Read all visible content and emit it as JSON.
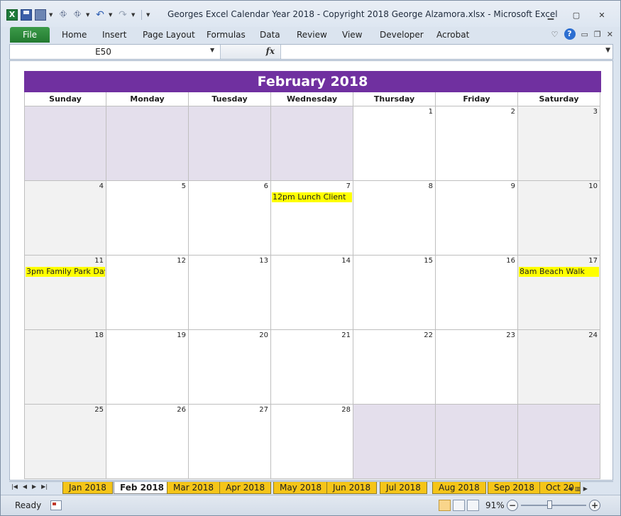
{
  "window": {
    "title": "Georges Excel Calendar Year 2018  -  Copyright 2018 George Alzamora.xlsx  -  Microsoft Excel"
  },
  "ribbon": {
    "file_label": "File",
    "tabs": [
      "Home",
      "Insert",
      "Page Layout",
      "Formulas",
      "Data",
      "Review",
      "View",
      "Developer",
      "Acrobat"
    ]
  },
  "formula_bar": {
    "name_box": "E50",
    "fx_label": "fx",
    "formula": ""
  },
  "calendar": {
    "title": "February 2018",
    "days_of_week": [
      "Sunday",
      "Monday",
      "Tuesday",
      "Wednesday",
      "Thursday",
      "Friday",
      "Saturday"
    ],
    "weeks": [
      [
        "",
        "",
        "",
        "",
        "1",
        "2",
        "3"
      ],
      [
        "4",
        "5",
        "6",
        "7",
        "8",
        "9",
        "10"
      ],
      [
        "11",
        "12",
        "13",
        "14",
        "15",
        "16",
        "17"
      ],
      [
        "18",
        "19",
        "20",
        "21",
        "22",
        "23",
        "24"
      ],
      [
        "25",
        "26",
        "27",
        "28",
        "",
        "",
        ""
      ]
    ],
    "events": {
      "d7": "12pm Lunch Client",
      "d11": "3pm Family Park Day",
      "d17": "8am Beach Walk"
    },
    "colors": {
      "title_bg": "#7030a0",
      "event_bg": "#ffff00",
      "blank_bg": "#e4dfec",
      "weekend_bg": "#f2f2f2"
    }
  },
  "sheet_tabs": [
    "Jan 2018",
    "Feb 2018",
    "Mar 2018",
    "Apr 2018",
    "May 2018",
    "Jun 2018",
    "Jul 2018",
    "Aug 2018",
    "Sep 2018",
    "Oct 20"
  ],
  "active_sheet": "Feb 2018",
  "status": {
    "ready": "Ready",
    "zoom": "91%",
    "zoom_value": 91
  }
}
